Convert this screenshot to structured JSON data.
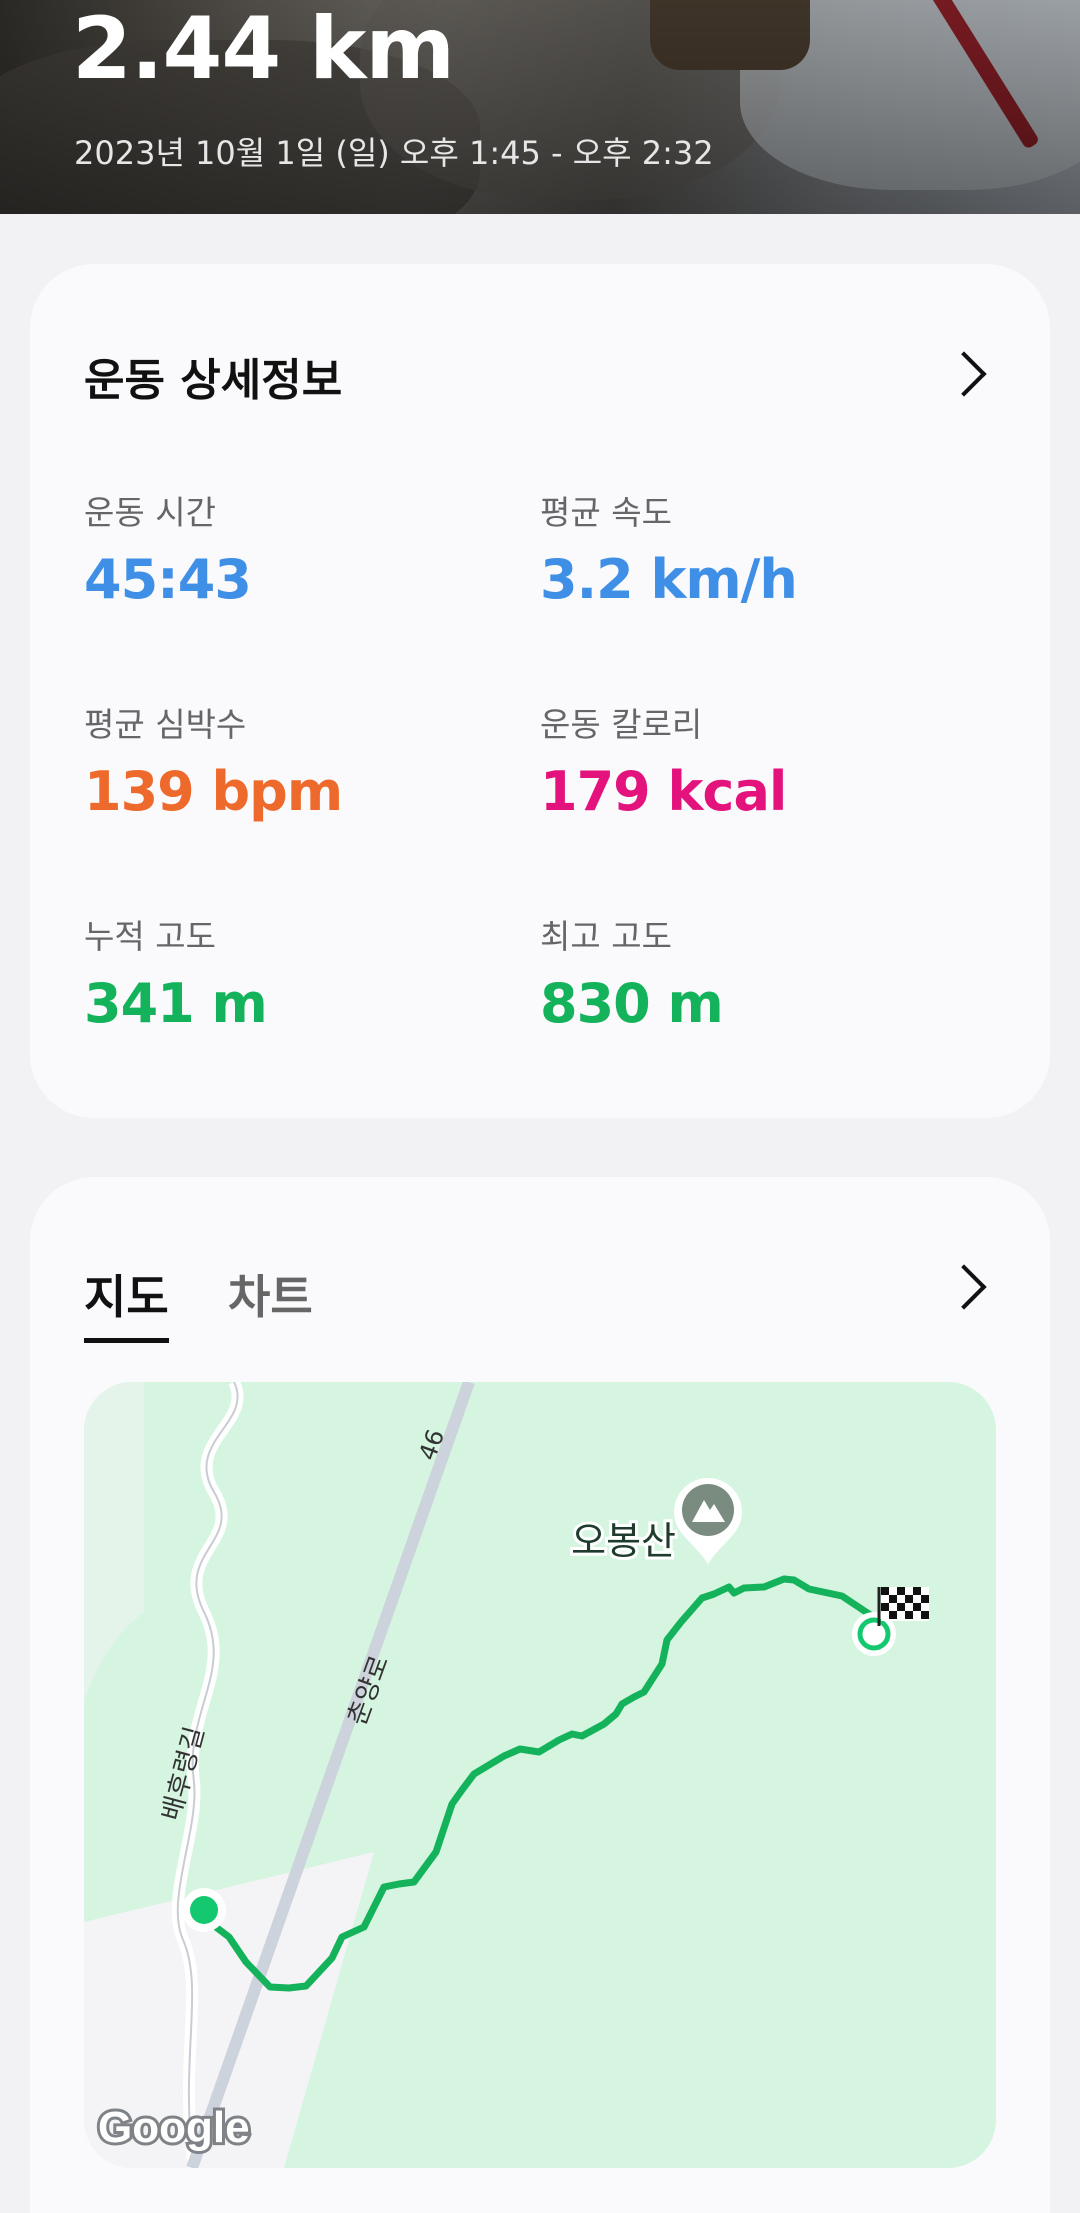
{
  "header": {
    "distance": "2.44 km",
    "datetime": "2023년 10월 1일 (일) 오후 1:45 - 오후 2:32"
  },
  "details": {
    "title": "운동 상세정보",
    "stats": [
      {
        "label": "운동 시간",
        "value": "45:43",
        "color": "#3e8fe5"
      },
      {
        "label": "평균 속도",
        "value": "3.2 km/h",
        "color": "#3e8fe5"
      },
      {
        "label": "평균 심박수",
        "value": "139 bpm",
        "color": "#ee6a2c"
      },
      {
        "label": "운동 칼로리",
        "value": "179 kcal",
        "color": "#e3127c"
      },
      {
        "label": "누적 고도",
        "value": "341 m",
        "color": "#14b35b"
      },
      {
        "label": "최고 고도",
        "value": "830 m",
        "color": "#14b35b"
      }
    ]
  },
  "map_section": {
    "tabs": [
      "지도",
      "차트"
    ],
    "active_tab": "지도",
    "map": {
      "road_number": "46",
      "road_name": "춘양로",
      "street_name": "배후령길",
      "peak_name": "오봉산",
      "attribution": "Google",
      "route_color": "#14b35b",
      "icons": [
        "mountain-icon",
        "finish-flag-icon",
        "start-marker",
        "end-marker"
      ]
    }
  }
}
